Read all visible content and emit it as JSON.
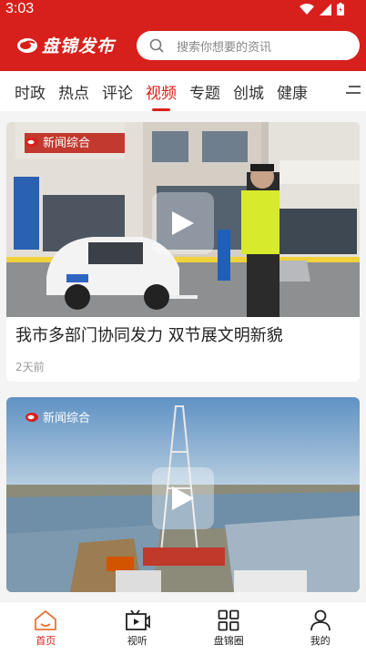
{
  "status": {
    "time": "3:03"
  },
  "header": {
    "app_name": "盘锦发布",
    "search_placeholder": "搜索你想要的资讯"
  },
  "tabs": [
    {
      "label": "时政"
    },
    {
      "label": "热点"
    },
    {
      "label": "评论"
    },
    {
      "label": "视频",
      "active": true
    },
    {
      "label": "专题"
    },
    {
      "label": "创城"
    },
    {
      "label": "健康"
    }
  ],
  "feed": [
    {
      "title": "我市多部门协同发力  双节展文明新貌",
      "meta": "2天前",
      "watermark": "新闻综合"
    },
    {
      "title": "",
      "meta": "",
      "watermark": "新闻综合"
    }
  ],
  "bottom_nav": [
    {
      "label": "首页",
      "icon": "home-icon",
      "active": true
    },
    {
      "label": "视听",
      "icon": "video-icon"
    },
    {
      "label": "盘锦圈",
      "icon": "grid-icon"
    },
    {
      "label": "我的",
      "icon": "user-icon"
    }
  ],
  "colors": {
    "brand_red": "#d7201c",
    "text": "#222222",
    "muted": "#999999"
  }
}
